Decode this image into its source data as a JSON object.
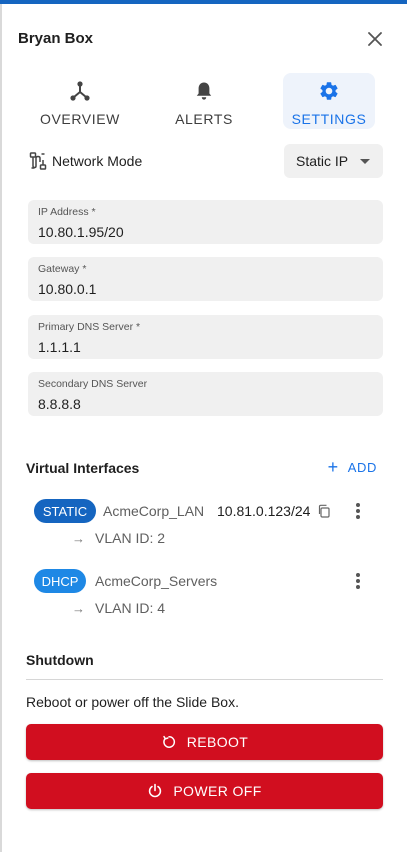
{
  "colors": {
    "accent": "#1a73e8",
    "top_bar": "#1565c0",
    "static_badge": "#1565c0",
    "dhcp_badge": "#1e88e5",
    "danger": "#d10e1f",
    "field_bg": "#f0f0f0"
  },
  "header": {
    "title": "Bryan Box",
    "close_icon": "close-icon"
  },
  "tabs": [
    {
      "label": "OVERVIEW",
      "icon": "network-hub-icon",
      "active": false
    },
    {
      "label": "ALERTS",
      "icon": "bell-icon",
      "active": false
    },
    {
      "label": "SETTINGS",
      "icon": "gear-icon",
      "active": true
    }
  ],
  "network_mode": {
    "label": "Network Mode",
    "icon": "ethernet-cable-icon",
    "selected": "Static IP"
  },
  "fields": [
    {
      "label": "IP Address *",
      "value": "10.80.1.95/20"
    },
    {
      "label": "Gateway *",
      "value": "10.80.0.1"
    },
    {
      "label": "Primary DNS Server *",
      "value": "1.1.1.1"
    },
    {
      "label": "Secondary DNS Server",
      "value": "8.8.8.8"
    }
  ],
  "virtual_interfaces": {
    "title": "Virtual Interfaces",
    "add_label": "ADD",
    "items": [
      {
        "type": "STATIC",
        "name": "AcmeCorp_LAN",
        "ip": "10.81.0.123/24",
        "vlan": "VLAN ID: 2"
      },
      {
        "type": "DHCP",
        "name": "AcmeCorp_Servers",
        "ip": "",
        "vlan": "VLAN ID: 4"
      }
    ]
  },
  "shutdown": {
    "title": "Shutdown",
    "description": "Reboot or power off the Slide Box.",
    "reboot_label": "REBOOT",
    "poweroff_label": "POWER OFF"
  }
}
